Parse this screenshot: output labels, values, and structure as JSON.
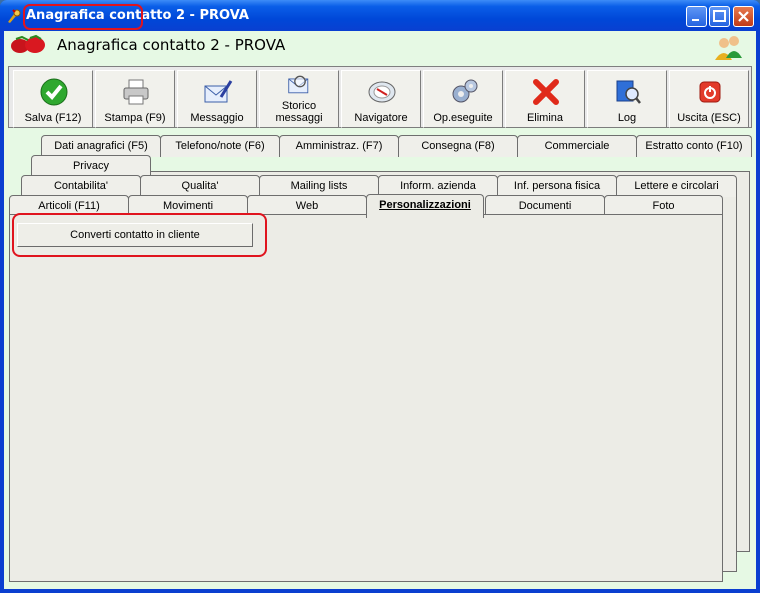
{
  "window": {
    "title": "Anagrafica contatto 2 - PROVA"
  },
  "header": {
    "title": "Anagrafica contatto 2 - PROVA"
  },
  "toolbar": [
    {
      "label": "Salva (F12)",
      "icon": "check-icon"
    },
    {
      "label": "Stampa (F9)",
      "icon": "printer-icon"
    },
    {
      "label": "Messaggio",
      "icon": "envelope-pen-icon"
    },
    {
      "label": "Storico\nmessaggi",
      "icon": "envelope-search-icon"
    },
    {
      "label": "Navigatore",
      "icon": "compass-icon"
    },
    {
      "label": "Op.eseguite",
      "icon": "gears-icon"
    },
    {
      "label": "Elimina",
      "icon": "red-x-icon"
    },
    {
      "label": "Log",
      "icon": "book-search-icon"
    },
    {
      "label": "Uscita (ESC)",
      "icon": "power-icon"
    }
  ],
  "tabs": {
    "row1": [
      "Dati anagrafici (F5)",
      "Telefono/note (F6)",
      "Amministraz. (F7)",
      "Consegna (F8)",
      "Commerciale",
      "Estratto conto (F10)"
    ],
    "row1b": [
      "Privacy"
    ],
    "row2": [
      "Contabilita'",
      "Qualita'",
      "Mailing lists",
      "Inform. azienda",
      "Inf. persona fisica",
      "Lettere e circolari"
    ],
    "row3": [
      "Articoli (F11)",
      "Movimenti",
      "Web",
      "Personalizzazioni",
      "Documenti",
      "Foto"
    ],
    "active": "Personalizzazioni"
  },
  "content": {
    "convert_button": "Converti contatto in cliente"
  },
  "colors": {
    "highlight": "#e0141e",
    "client_bg": "#e6f9e4",
    "titlebar": "#0a5ee8"
  }
}
